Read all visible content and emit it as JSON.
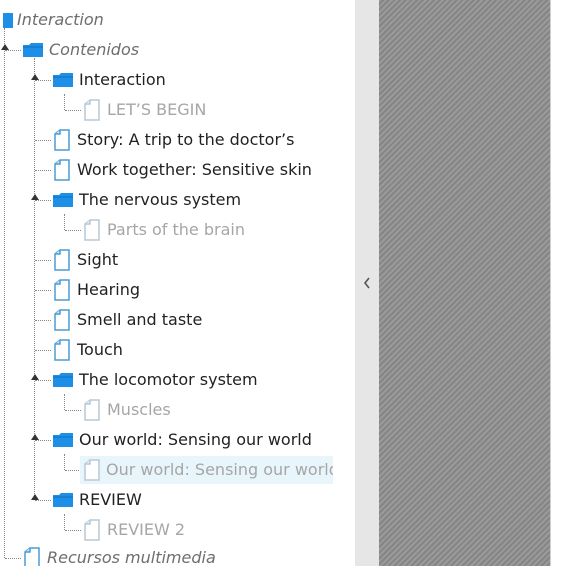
{
  "tree": {
    "root": {
      "label": "Interaction"
    },
    "nodes": [
      {
        "id": "contenidos",
        "label": "Contenidos",
        "type": "folder",
        "style": "italic"
      },
      {
        "id": "interaction",
        "label": "Interaction",
        "type": "folder",
        "style": "normal"
      },
      {
        "id": "lets-begin",
        "label": "LET’S BEGIN",
        "type": "page",
        "style": "muted"
      },
      {
        "id": "story",
        "label": "Story: A trip to the doctor’s",
        "type": "page",
        "style": "normal"
      },
      {
        "id": "work-together",
        "label": "Work together: Sensitive skin",
        "type": "page",
        "style": "normal"
      },
      {
        "id": "nervous-system",
        "label": "The nervous system",
        "type": "folder",
        "style": "normal"
      },
      {
        "id": "parts-of-brain",
        "label": "Parts of the brain",
        "type": "page",
        "style": "muted"
      },
      {
        "id": "sight",
        "label": "Sight",
        "type": "page",
        "style": "normal"
      },
      {
        "id": "hearing",
        "label": "Hearing",
        "type": "page",
        "style": "normal"
      },
      {
        "id": "smell-taste",
        "label": "Smell and taste",
        "type": "page",
        "style": "normal"
      },
      {
        "id": "touch",
        "label": "Touch",
        "type": "page",
        "style": "normal"
      },
      {
        "id": "locomotor",
        "label": "The locomotor system",
        "type": "folder",
        "style": "normal"
      },
      {
        "id": "muscles",
        "label": "Muscles",
        "type": "page",
        "style": "muted"
      },
      {
        "id": "our-world",
        "label": "Our world: Sensing our world",
        "type": "folder",
        "style": "normal"
      },
      {
        "id": "our-world-page",
        "label": "Our world: Sensing our world",
        "type": "page",
        "style": "muted",
        "selected": true
      },
      {
        "id": "review",
        "label": "REVIEW",
        "type": "folder",
        "style": "normal"
      },
      {
        "id": "review-2",
        "label": "REVIEW 2",
        "type": "page",
        "style": "muted"
      },
      {
        "id": "recursos",
        "label": "Recursos multimedia",
        "type": "page",
        "style": "italic"
      }
    ]
  },
  "icons": {
    "folder": "folder-icon",
    "page": "page-icon",
    "expander": "collapse-arrow-icon",
    "splitter": "chevron-left-icon"
  },
  "colors": {
    "folder_blue": "#1e8fe6",
    "page_outline": "#4a9bd6",
    "page_outline_muted": "#b7c9d6",
    "selected_bg": "#e8f6fc",
    "muted_text": "#a6a6a6",
    "italic_text": "#6e6e6e",
    "splitter_bg": "#e6e6e6",
    "content_pattern": "#8f8f8f"
  }
}
